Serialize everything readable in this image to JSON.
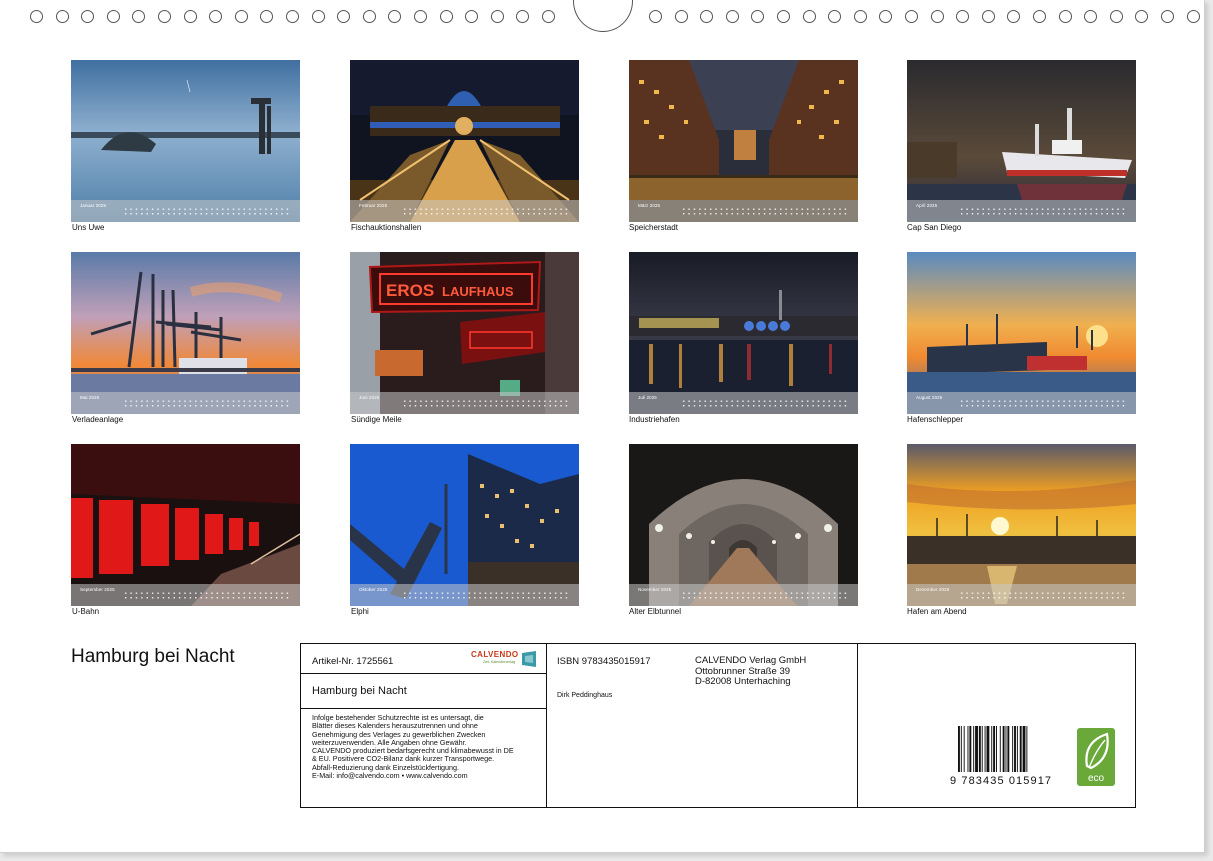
{
  "calendar": {
    "title": "Hamburg bei Nacht",
    "months": [
      {
        "label": "Januar 2025",
        "caption": "Uns Uwe",
        "scene": "harbor-blue"
      },
      {
        "label": "Februar 2025",
        "caption": "Fischauktionshallen",
        "scene": "fish-hall"
      },
      {
        "label": "März 2025",
        "caption": "Speicherstadt",
        "scene": "speicherstadt"
      },
      {
        "label": "April 2025",
        "caption": "Cap San Diego",
        "scene": "ship"
      },
      {
        "label": "Mai 2025",
        "caption": "Verladeanlage",
        "scene": "cranes-sunset"
      },
      {
        "label": "Juni 2025",
        "caption": "Sündige Meile",
        "scene": "neon"
      },
      {
        "label": "Juli 2025",
        "caption": "Industriehafen",
        "scene": "industry-night"
      },
      {
        "label": "August 2025",
        "caption": "Hafenschlepper",
        "scene": "tugs-sunset"
      },
      {
        "label": "September 2025",
        "caption": "U-Bahn",
        "scene": "subway-red"
      },
      {
        "label": "Oktober 2025",
        "caption": "Elphi",
        "scene": "elphi"
      },
      {
        "label": "November 2025",
        "caption": "Alter Elbtunnel",
        "scene": "tunnel"
      },
      {
        "label": "Dezember 2025",
        "caption": "Hafen am Abend",
        "scene": "harbor-evening"
      }
    ],
    "neon_sign": {
      "word1": "EROS",
      "word2": "LAUFHAUS"
    }
  },
  "info": {
    "article": "Artikel-Nr. 1725561",
    "logo": {
      "name": "CALVENDO",
      "tagline": "Zeit. Kalenderverlag"
    },
    "title": "Hamburg bei Nacht",
    "legal": "Infolge bestehender Schutzrechte ist es untersagt, die\nBlätter dieses Kalenders herauszutrennen und ohne\nGenehmigung des Verlages zu gewerblichen Zwecken\nweiterzuverwenden. Alle Angaben ohne Gewähr.\nCALVENDO produziert bedarfsgerecht und klimabewusst in DE\n& EU. Positivere CO2-Bilanz dank kurzer Transportwege.\nAbfall-Reduzierung dank Einzelstückfertigung.\nE-Mail: info@calvendo.com • www.calvendo.com",
    "isbn": "ISBN 9783435015917",
    "publisher": "CALVENDO Verlag GmbH\nOttobrunner Straße 39\nD-82008 Unterhaching",
    "author": "Dirk Peddinghaus",
    "barcode_number": "9 783435 015917",
    "eco_label": "eco"
  },
  "colors": {
    "border": "#111111",
    "neon_red": "#ff3b2f",
    "eco_green": "#6aa83a",
    "logo_red": "#c83a1a"
  }
}
